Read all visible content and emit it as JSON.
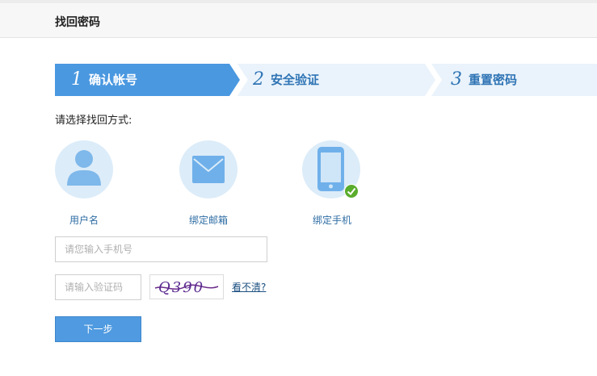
{
  "header": {
    "title": "找回密码"
  },
  "steps": [
    {
      "num": "1",
      "label": "确认帐号"
    },
    {
      "num": "2",
      "label": "安全验证"
    },
    {
      "num": "3",
      "label": "重置密码"
    }
  ],
  "colors": {
    "step_active": "#4a98e0",
    "step_inactive": "#eaf3fb",
    "step_inactive_text": "#2f74b5",
    "link": "#2e6da4",
    "button": "#4f9ae0",
    "check": "#5aac2c"
  },
  "form": {
    "prompt": "请选择找回方式:",
    "methods": [
      {
        "label": "用户名",
        "icon": "user-icon"
      },
      {
        "label": "绑定邮箱",
        "icon": "envelope-icon"
      },
      {
        "label": "绑定手机",
        "icon": "phone-icon",
        "selected": true
      }
    ],
    "phone_placeholder": "请您输入手机号",
    "code_placeholder": "请输入验证码",
    "captcha_text": "Q390",
    "refresh_link": "看不清?",
    "next_button": "下一步"
  }
}
